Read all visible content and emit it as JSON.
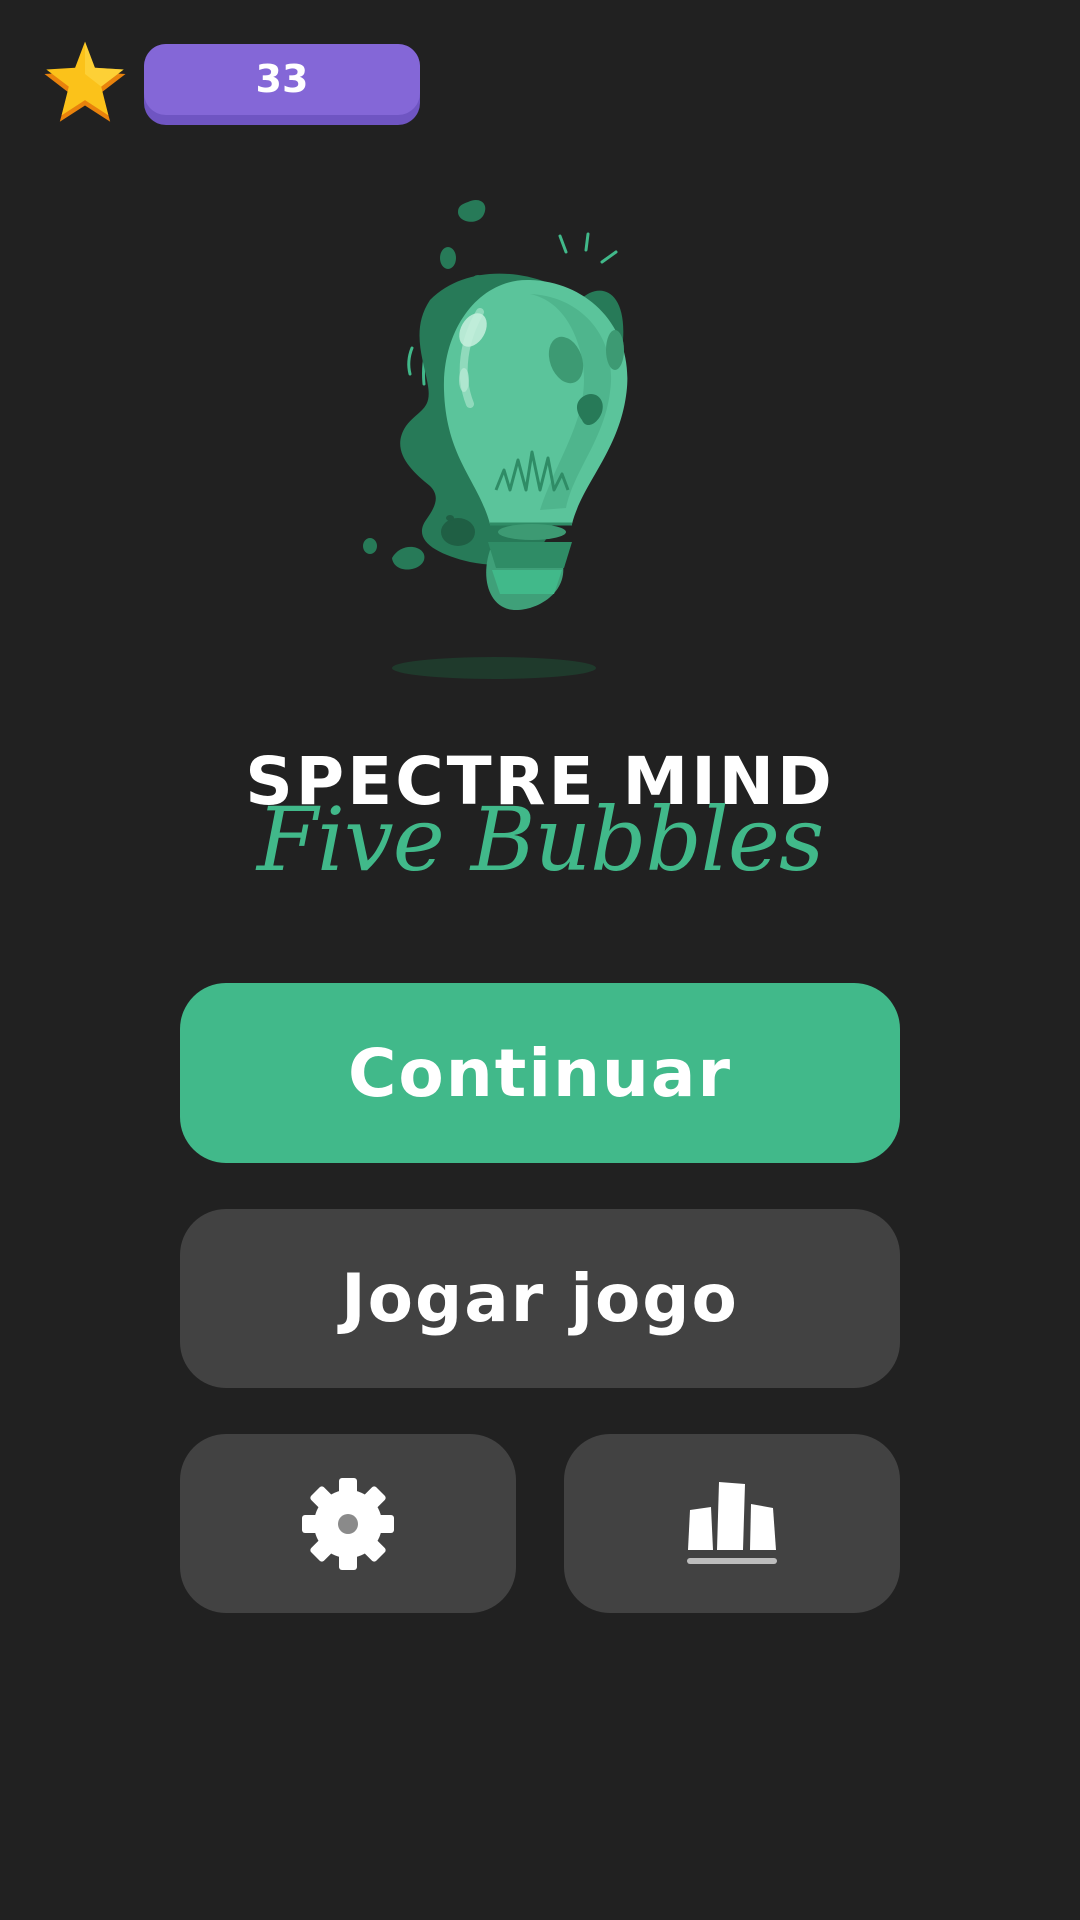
{
  "header": {
    "star_icon": "star-icon",
    "score": "33"
  },
  "title": {
    "main": "SPECTRE MIND",
    "sub": "Five Bubbles"
  },
  "buttons": {
    "continue_label": "Continuar",
    "play_label": "Jogar jogo",
    "settings_icon": "gear-icon",
    "stats_icon": "leaderboard-icon"
  },
  "colors": {
    "background": "#212121",
    "accent_green": "#41b98a",
    "button_gray": "#424242",
    "score_purple": "#8467d7"
  }
}
